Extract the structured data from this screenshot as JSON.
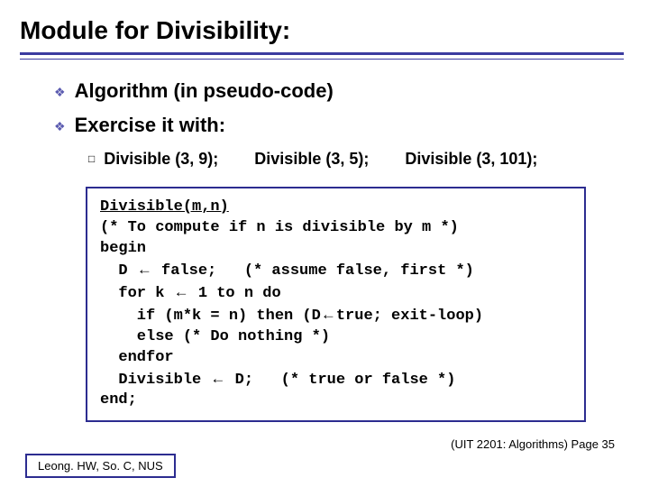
{
  "title": "Module for Divisibility:",
  "bullets": {
    "b1": "Algorithm (in pseudo-code)",
    "b2": "Exercise it with:",
    "examples": {
      "e1": "Divisible (3, 9);",
      "e2": "Divisible (3, 5);",
      "e3": "Divisible (3, 101);"
    }
  },
  "code": {
    "l1": "Divisible(m,n)",
    "l2": "(* To compute if n is divisible by m *)",
    "l3": "begin",
    "l4a": "  D ",
    "l4b": " false;   (* assume false, first *)",
    "l5a": "  for k ",
    "l5b": " 1 to n do",
    "l6a": "    if (m*k = n) then (D",
    "l6b": "true; exit-loop)",
    "l7": "    else (* Do nothing *)",
    "l8": "  endfor",
    "l9a": "  Divisible ",
    "l9b": " D;   (* true or false *)",
    "l10": "end;"
  },
  "arrow": "←",
  "footer": {
    "right": "(UIT 2201: Algorithms) Page 35",
    "left": "Leong. HW, So. C, NUS"
  },
  "chart_data": {
    "type": "table",
    "title": "Pseudo-code: Divisible(m,n)",
    "rows": [
      "Divisible(m,n)",
      "(* To compute if n is divisible by m *)",
      "begin",
      "  D ← false;   (* assume false, first *)",
      "  for k ← 1 to n do",
      "    if (m*k = n) then (D←true; exit-loop)",
      "    else (* Do nothing *)",
      "  endfor",
      "  Divisible ← D;   (* true or false *)",
      "end;"
    ],
    "examples": [
      "Divisible (3, 9);",
      "Divisible (3, 5);",
      "Divisible (3, 101);"
    ]
  }
}
